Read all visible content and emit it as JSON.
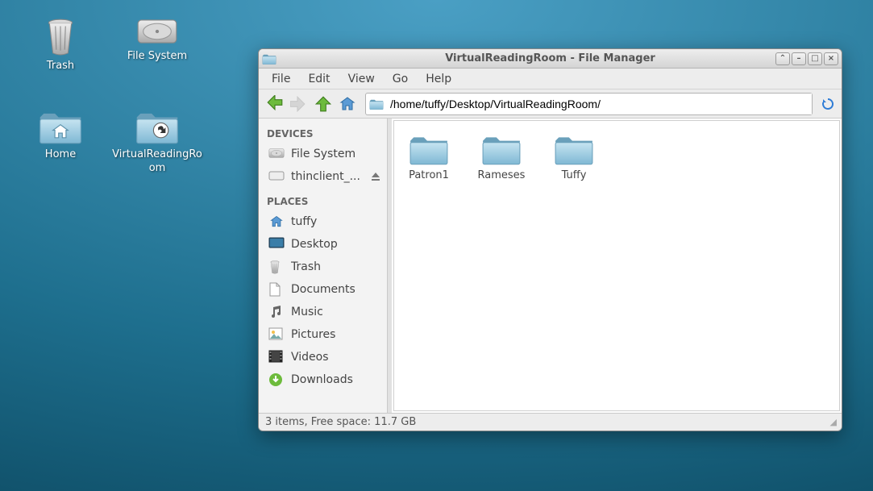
{
  "desktop": {
    "row1": [
      {
        "key": "trash",
        "label": "Trash",
        "icon": "trash-icon"
      },
      {
        "key": "filesystem",
        "label": "File System",
        "icon": "drive-icon"
      }
    ],
    "row2": [
      {
        "key": "home",
        "label": "Home",
        "icon": "home-folder-icon"
      },
      {
        "key": "vrr",
        "label": "VirtualReadingRo\nom",
        "icon": "folder-link-icon"
      }
    ]
  },
  "window": {
    "title": "VirtualReadingRoom - File Manager",
    "buttons": {
      "rollup": "⌃",
      "min": "–",
      "max": "□",
      "close": "×"
    }
  },
  "menu": [
    "File",
    "Edit",
    "View",
    "Go",
    "Help"
  ],
  "toolbar": {
    "path": "/home/tuffy/Desktop/VirtualReadingRoom/"
  },
  "sidebar": {
    "devices_header": "DEVICES",
    "devices": [
      {
        "key": "filesystem",
        "label": "File System",
        "icon": "drive-icon"
      },
      {
        "key": "thinclient",
        "label": "thinclient_...",
        "icon": "removable-icon",
        "eject": true
      }
    ],
    "places_header": "PLACES",
    "places": [
      {
        "key": "tuffy",
        "label": "tuffy",
        "icon": "home-icon"
      },
      {
        "key": "desktop",
        "label": "Desktop",
        "icon": "desktop-icon"
      },
      {
        "key": "trash",
        "label": "Trash",
        "icon": "trash-small-icon"
      },
      {
        "key": "documents",
        "label": "Documents",
        "icon": "document-icon"
      },
      {
        "key": "music",
        "label": "Music",
        "icon": "music-icon"
      },
      {
        "key": "pictures",
        "label": "Pictures",
        "icon": "pictures-icon"
      },
      {
        "key": "videos",
        "label": "Videos",
        "icon": "videos-icon"
      },
      {
        "key": "downloads",
        "label": "Downloads",
        "icon": "downloads-icon"
      }
    ]
  },
  "folders": [
    {
      "key": "patron1",
      "label": "Patron1"
    },
    {
      "key": "rameses",
      "label": "Rameses"
    },
    {
      "key": "tuffy",
      "label": "Tuffy"
    }
  ],
  "status": "3 items, Free space: 11.7 GB"
}
